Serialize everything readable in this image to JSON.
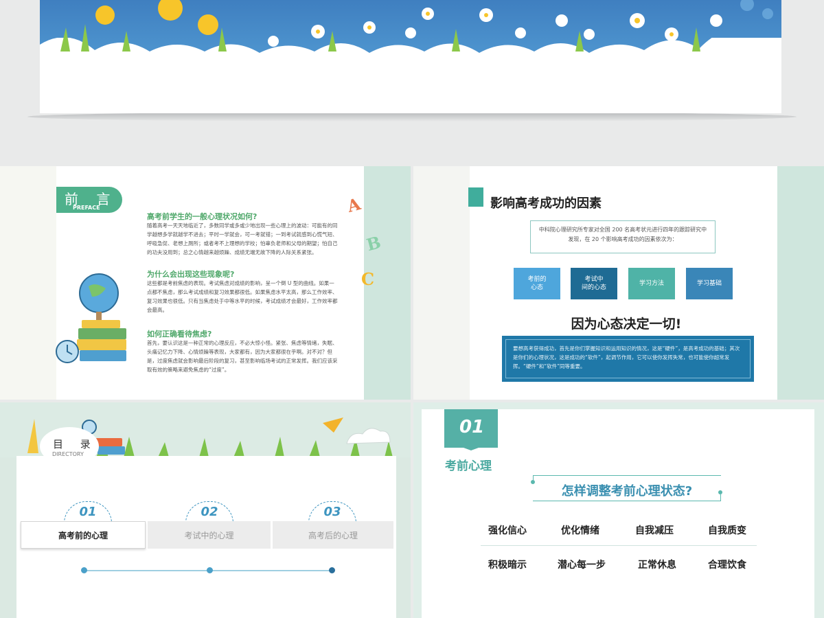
{
  "slide1": {
    "tab_cn": "前 言",
    "tab_en": "PREFACE",
    "sections": [
      {
        "heading": "高考前学生的一般心理状况如何?",
        "body": "随着高考一天天地临近了，多数同学或多或少地出现一些心理上的波动：可能有的同学越想多学就越学不进去；平时一学就会，可一考就错；一到考试就感到心慌气短、呼吸急促、老想上厕所；或者考不上理想的学校；怕辜负老师和父母的期望；怕自己的功夫没用到；总之心情越来越烦躁、成绩无端无故下降的人际关系紧张。"
      },
      {
        "heading": "为什么会出现这些现象呢?",
        "body": "这些都是考前焦虑的表现。考试焦虑对成绩的影响，呈一个倒 U 型的曲线。如果一点都不焦虑，那么考试成绩和复习效果都很低。如果焦虑水平太高，那么工作效率、复习效果也很低。只有当焦虑处于中等水平的时候，考试成绩才会最好，工作效率都会最高。"
      },
      {
        "heading": "如何正确看待焦虑?",
        "body": "首先，要认识这是一种正常的心理反应，不必大惊小怪。紧张、焦虑等情绪，失眠、头痛记忆力下降、心情烦躁等表现，大家都有，因为大家都很在乎啊。对不对？但是，过度焦虑就会影响最后阶段的复习，甚至影响临场考试的正常发挥。我们应该采取有效的策略来避免焦虑的“过度”。"
      }
    ],
    "letters": [
      "A",
      "B",
      "C"
    ]
  },
  "slide2": {
    "title": "影响高考成功的因素",
    "intro": "中科院心理研究所专家对全国 200 名高考状元进行四年的跟踪研究中发现，在 20 个影响高考成功的因素依次为：",
    "factors": [
      {
        "label": "考前的\n心态",
        "color": "#4ea6dc"
      },
      {
        "label": "考试中\n间的心态",
        "color": "#1f6b94"
      },
      {
        "label": "学习方法",
        "color": "#4fb3a7"
      },
      {
        "label": "学习基础",
        "color": "#3a86b8"
      }
    ],
    "slogan": "因为心态决定一切!",
    "note": "要想高考获得成功，首先是你们掌握知识和运用知识的情况，这是“硬件”，是高考成功的基础；其次是你们的心理状况，这是成功的“软件”，起调节作用，它可以使你发挥失常，也可能使你超常发挥。“硬件”和“软件”同等重要。"
  },
  "slide3": {
    "title_cn": "目 录",
    "title_en": "DIRECTORY",
    "items": [
      {
        "num": "01",
        "label": "高考前的心理"
      },
      {
        "num": "02",
        "label": "考试中的心理"
      },
      {
        "num": "03",
        "label": "高考后的心理"
      }
    ]
  },
  "slide4": {
    "number": "01",
    "title": "考前心理",
    "question": "怎样调整考前心理状态?",
    "tips_row1": [
      "强化信心",
      "优化情绪",
      "自我减压",
      "自我质变"
    ],
    "tips_row2": [
      "积极暗示",
      "潜心每一步",
      "正常休息",
      "合理饮食"
    ]
  }
}
